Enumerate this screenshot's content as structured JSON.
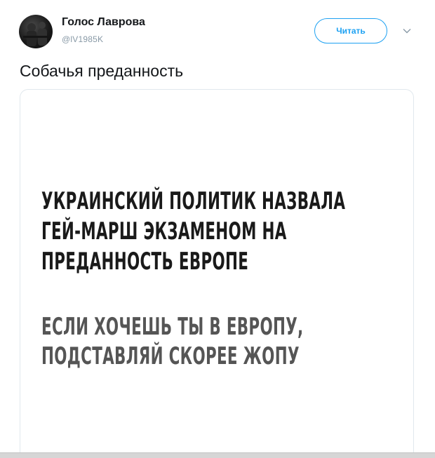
{
  "tweet": {
    "author_name": "Голос Лаврова",
    "author_handle": "@lV1985K",
    "follow_label": "Читать",
    "text": "Собачья преданность"
  },
  "media": {
    "headline_lines": [
      "УКРАИНСКИЙ ПОЛИТИК НАЗВАЛА",
      "ГЕЙ-МАРШ ЭКЗАМЕНОМ НА",
      "ПРЕДАННОСТЬ ЕВРОПЕ"
    ],
    "subline_lines": [
      "ЕСЛИ ХОЧЕШЬ ТЫ В ЕВРОПУ,",
      "ПОДСТАВЛЯЙ СКОРЕЕ ЖОПУ"
    ]
  },
  "colors": {
    "accent": "#1da1f2",
    "text": "#14171a",
    "muted": "#8899a6",
    "headline": "#1a1a1a",
    "subline": "#555555"
  },
  "icons": {
    "avatar": "user-avatar-photo",
    "caret": "chevron-down-icon"
  }
}
